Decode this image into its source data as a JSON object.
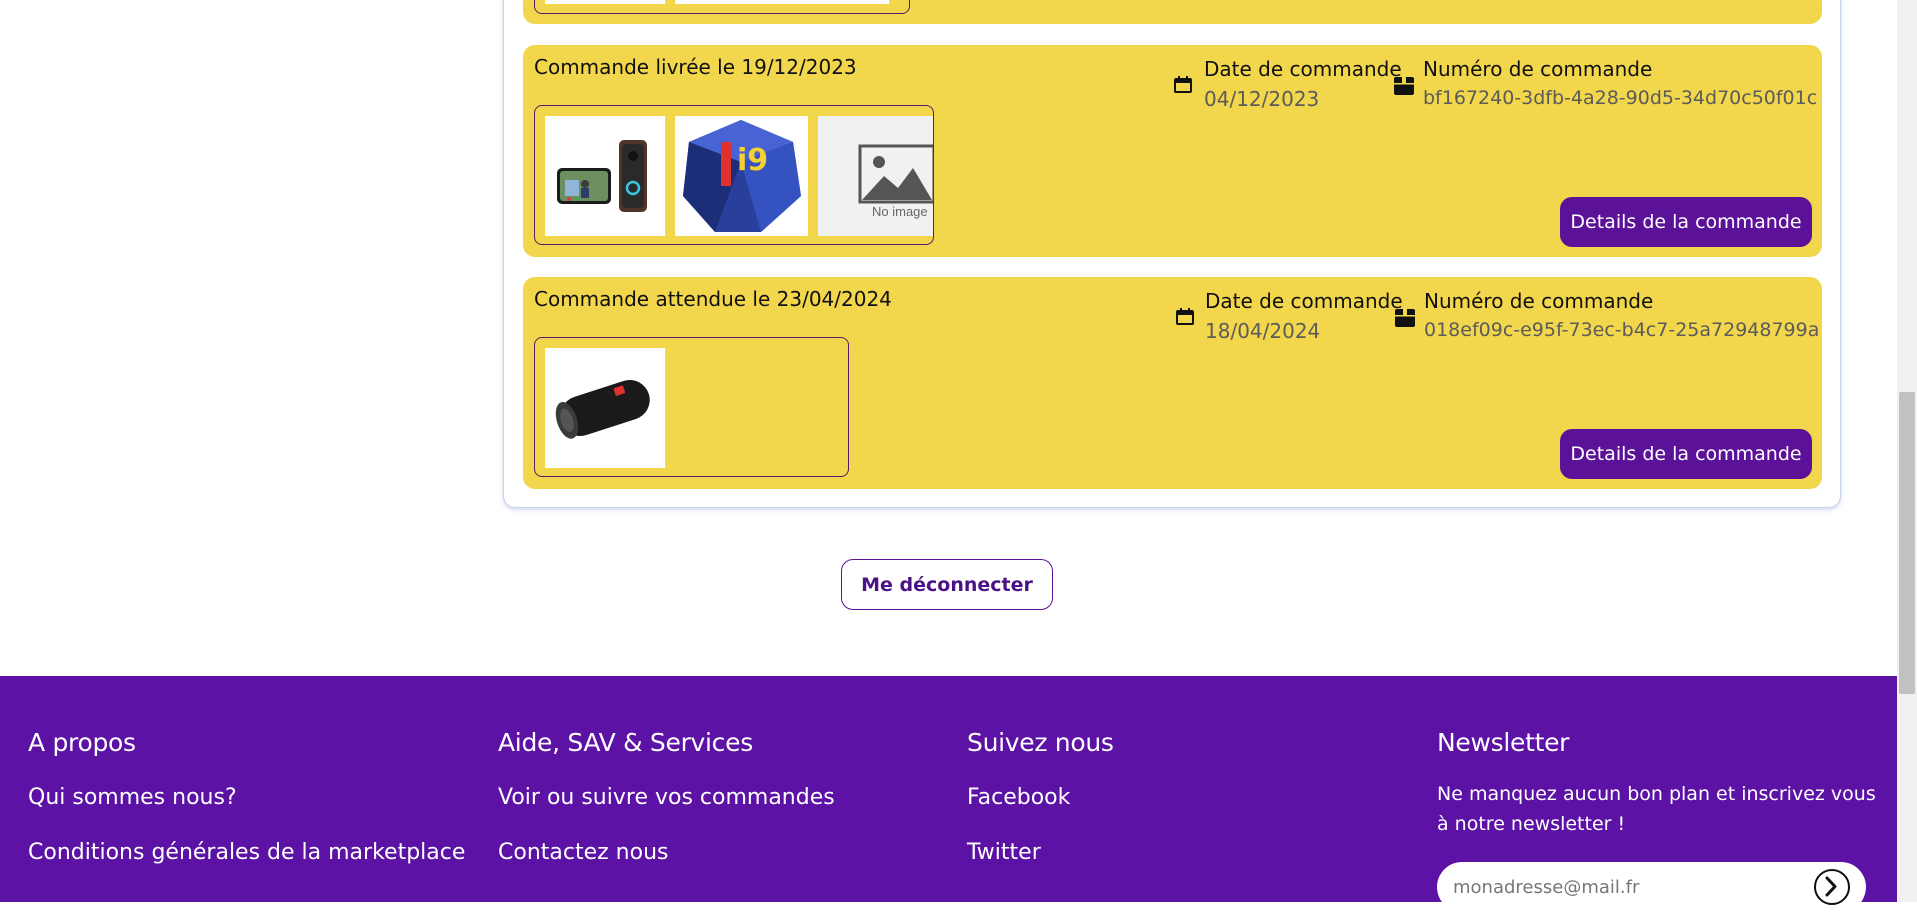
{
  "orders": [
    {
      "status": "Commande livrée le 19/12/2023",
      "date_label": "Date de commande",
      "date_value": "04/12/2023",
      "number_label": "Numéro de commande",
      "number_value": "bf167240-3dfb-4a28-90d5-34d70c50f01c",
      "details_label": "Details de la commande",
      "thumbnails": [
        "video-doorbell",
        "intel-core-i9-box",
        "no-image-placeholder"
      ],
      "no_image_text": "No image"
    },
    {
      "status": "Commande attendue le 23/04/2024",
      "date_label": "Date de commande",
      "date_value": "18/04/2024",
      "number_label": "Numéro de commande",
      "number_value": "018ef09c-e95f-73ec-b4c7-25a72948799a",
      "details_label": "Details de la commande",
      "thumbnails": [
        "bluetooth-speaker"
      ]
    }
  ],
  "logout_label": "Me déconnecter",
  "footer": {
    "about": {
      "title": "A propos",
      "links": [
        "Qui sommes nous?",
        "Conditions générales de la marketplace"
      ]
    },
    "help": {
      "title": "Aide, SAV & Services",
      "links": [
        "Voir ou suivre vos commandes",
        "Contactez nous"
      ]
    },
    "social": {
      "title": "Suivez nous",
      "links": [
        "Facebook",
        "Twitter"
      ]
    },
    "newsletter": {
      "title": "Newsletter",
      "text": "Ne manquez aucun bon plan et inscrivez vous à notre newsletter !",
      "placeholder": "monadresse@mail.fr"
    }
  },
  "colors": {
    "card": "#f2d64b",
    "accent": "#5c1199",
    "footer": "#5c12a5"
  },
  "icons": {
    "date": "calendar-icon",
    "number": "package-icon",
    "submit": "arrow-right-circle-icon"
  }
}
